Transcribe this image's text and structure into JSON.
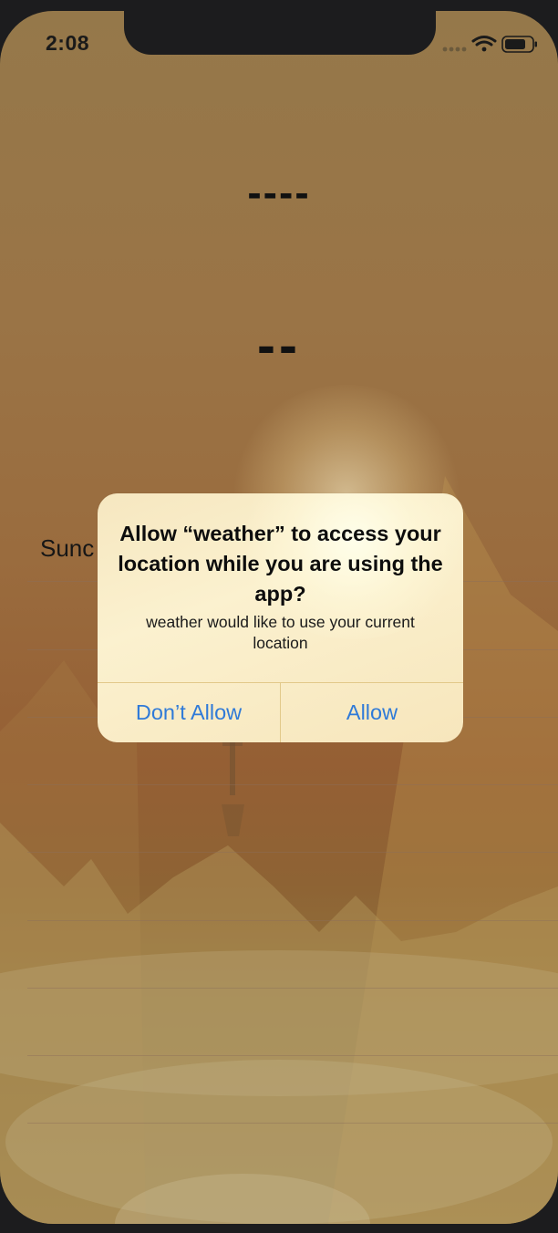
{
  "status_bar": {
    "time": "2:08",
    "icons": [
      "signal-dots-icon",
      "wifi-icon",
      "battery-icon"
    ]
  },
  "weather": {
    "placeholder_primary": "----",
    "placeholder_secondary": "--",
    "day_label": "Sunc"
  },
  "alert": {
    "title": "Allow “weather” to access your location while you are using the app?",
    "message": "weather would like to use your current location",
    "deny_label": "Don’t Allow",
    "allow_label": "Allow"
  },
  "colors": {
    "alert_button_text": "#2f7ad8",
    "alert_background": "#fbf1cf",
    "background_top": "#95784a",
    "background_mid": "#955f34",
    "background_bottom": "#9a8453"
  }
}
